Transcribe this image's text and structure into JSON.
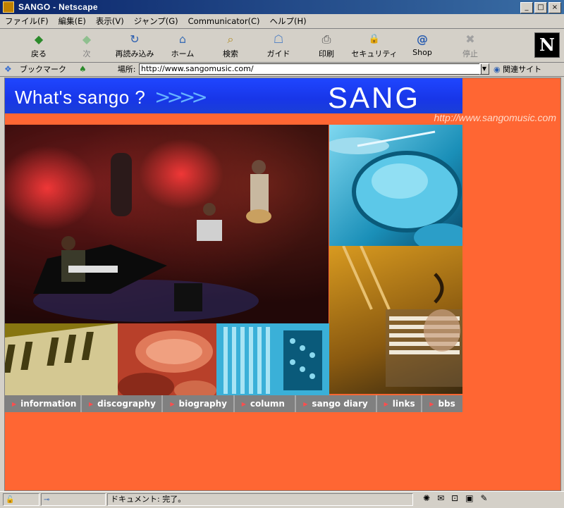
{
  "window": {
    "title": "SANGO - Netscape",
    "controls": {
      "minimize": "_",
      "maximize": "□",
      "close": "×"
    }
  },
  "menu": [
    "ファイル(F)",
    "編集(E)",
    "表示(V)",
    "ジャンプ(G)",
    "Communicator(C)",
    "ヘルプ(H)"
  ],
  "toolbar": [
    {
      "label": "戻る",
      "icon": "back-icon",
      "glyph": "◆"
    },
    {
      "label": "次",
      "icon": "forward-icon",
      "glyph": "◆"
    },
    {
      "label": "再読み込み",
      "icon": "reload-icon",
      "glyph": "↻"
    },
    {
      "label": "ホーム",
      "icon": "home-icon",
      "glyph": "⌂"
    },
    {
      "label": "検索",
      "icon": "search-icon",
      "glyph": "⌕"
    },
    {
      "label": "ガイド",
      "icon": "guide-icon",
      "glyph": "☖"
    },
    {
      "label": "印刷",
      "icon": "print-icon",
      "glyph": "⎙"
    },
    {
      "label": "セキュリティ",
      "icon": "security-icon",
      "glyph": "🔒"
    },
    {
      "label": "Shop",
      "icon": "shop-icon",
      "glyph": "@"
    },
    {
      "label": "停止",
      "icon": "stop-icon",
      "glyph": "✖"
    }
  ],
  "brand": {
    "logo": "N"
  },
  "location": {
    "bookmarks": "ブックマーク",
    "label": "場所:",
    "url": "http://www.sangomusic.com/",
    "related": "関連サイト"
  },
  "page": {
    "header_title": "What's sango ?",
    "logo_text": "SANG",
    "site_url": "http://www.sangomusic.com",
    "bg_color": "#ff6633",
    "nav": [
      "information",
      "discography",
      "biography",
      "column",
      "sango diary",
      "links",
      "bbs"
    ]
  },
  "status": {
    "text": "ドキュメント: 完了。"
  }
}
